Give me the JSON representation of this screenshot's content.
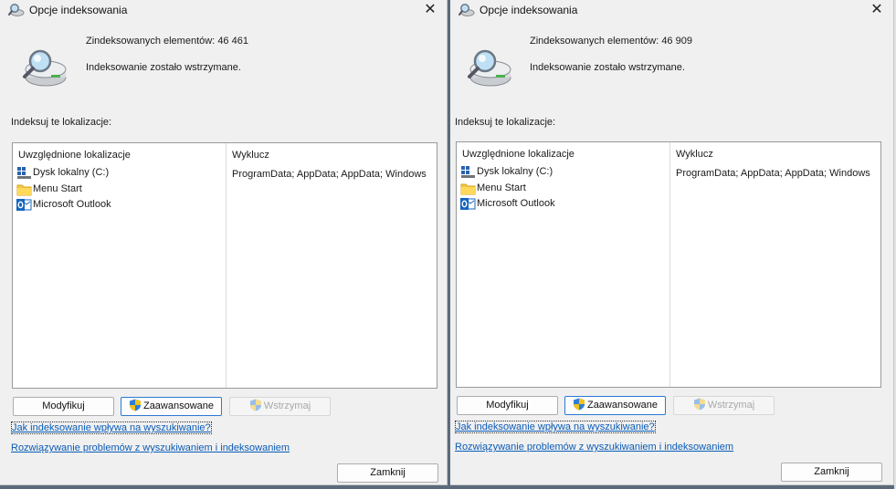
{
  "dialogs": [
    {
      "title": "Opcje indeksowania",
      "indexed_label": "Zindeksowanych elementów:",
      "indexed_count": "46 461",
      "status": "Indeksowanie zostało wstrzymane.",
      "section_label": "Indeksuj te lokalizacje:",
      "col_included": "Uwzględnione lokalizacje",
      "col_excluded": "Wyklucz",
      "locations": [
        "Dysk lokalny (C:)",
        "Menu Start",
        "Microsoft Outlook"
      ],
      "excluded": "ProgramData; AppData; AppData; Windows",
      "buttons": {
        "modify": "Modyfikuj",
        "advanced": "Zaawansowane",
        "pause": "Wstrzymaj",
        "close": "Zamknij"
      },
      "links": {
        "how": "Jak indeksowanie wpływa na wyszukiwanie?",
        "troubleshoot": "Rozwiązywanie problemów z wyszukiwaniem i indeksowaniem"
      }
    },
    {
      "title": "Opcje indeksowania",
      "indexed_label": "Zindeksowanych elementów:",
      "indexed_count": "46 909",
      "status": "Indeksowanie zostało wstrzymane.",
      "section_label": "Indeksuj te lokalizacje:",
      "col_included": "Uwzględnione lokalizacje",
      "col_excluded": "Wyklucz",
      "locations": [
        "Dysk lokalny (C:)",
        "Menu Start",
        "Microsoft Outlook"
      ],
      "excluded": "ProgramData; AppData; AppData; Windows",
      "buttons": {
        "modify": "Modyfikuj",
        "advanced": "Zaawansowane",
        "pause": "Wstrzymaj",
        "close": "Zamknij"
      },
      "links": {
        "how": "Jak indeksowanie wpływa na wyszukiwanie?",
        "troubleshoot": "Rozwiązywanie problemów z wyszukiwaniem i indeksowaniem"
      }
    }
  ],
  "icons": {
    "title": "indexing-options-icon",
    "big": "magnifier-drive-icon",
    "drive": "windows-drive-icon",
    "folder": "folder-icon",
    "outlook": "outlook-icon",
    "shield": "uac-shield-icon",
    "close": "close-icon"
  },
  "colors": {
    "accent": "#2b79d6",
    "link": "#0a5cb8",
    "window_bg": "#f0f0f0"
  }
}
